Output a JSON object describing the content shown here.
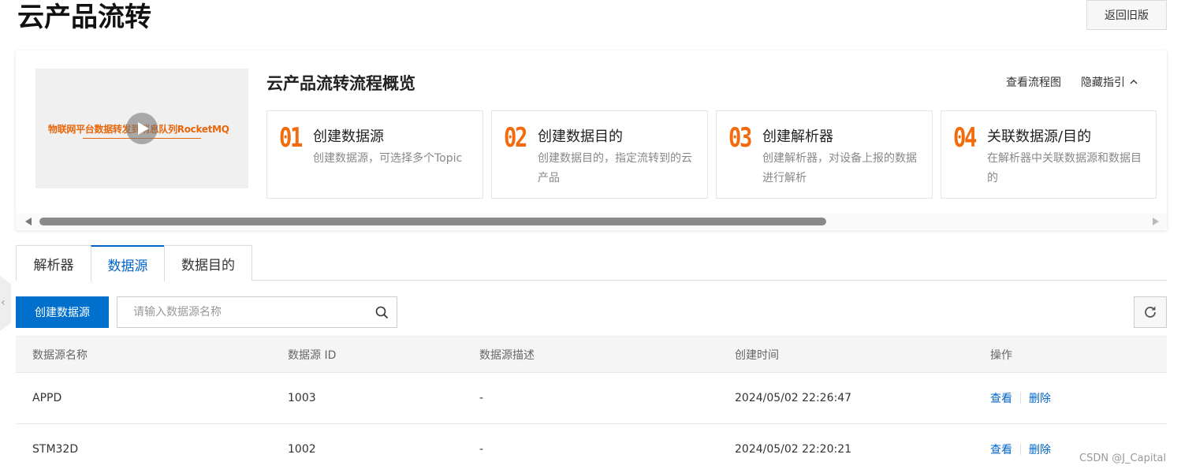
{
  "header": {
    "title": "云产品流转",
    "old_version_label": "返回旧版"
  },
  "guide": {
    "video_text": "物联网平台数据转发到消息队列RocketMQ",
    "title": "云产品流转流程概览",
    "view_flow_label": "查看流程图",
    "hide_guide_label": "隐藏指引",
    "steps": [
      {
        "num": "01",
        "title": "创建数据源",
        "desc": "创建数据源，可选择多个Topic"
      },
      {
        "num": "02",
        "title": "创建数据目的",
        "desc": "创建数据目的，指定流转到的云产品"
      },
      {
        "num": "03",
        "title": "创建解析器",
        "desc": "创建解析器，对设备上报的数据进行解析"
      },
      {
        "num": "04",
        "title": "关联数据源/目的",
        "desc": "在解析器中关联数据源和数据目的"
      }
    ]
  },
  "tabs": [
    {
      "label": "解析器"
    },
    {
      "label": "数据源"
    },
    {
      "label": "数据目的"
    }
  ],
  "toolbar": {
    "create_label": "创建数据源",
    "search_placeholder": "请输入数据源名称"
  },
  "table": {
    "columns": [
      "数据源名称",
      "数据源 ID",
      "数据源描述",
      "创建时间",
      "操作"
    ],
    "rows": [
      {
        "name": "APPD",
        "id": "1003",
        "desc": "-",
        "time": "2024/05/02 22:26:47"
      },
      {
        "name": "STM32D",
        "id": "1002",
        "desc": "-",
        "time": "2024/05/02 22:20:21"
      }
    ],
    "actions": {
      "view": "查看",
      "delete": "删除"
    }
  },
  "watermark": "CSDN @J_Capital",
  "colors": {
    "primary": "#0070cc",
    "accent": "#f26c0d"
  }
}
